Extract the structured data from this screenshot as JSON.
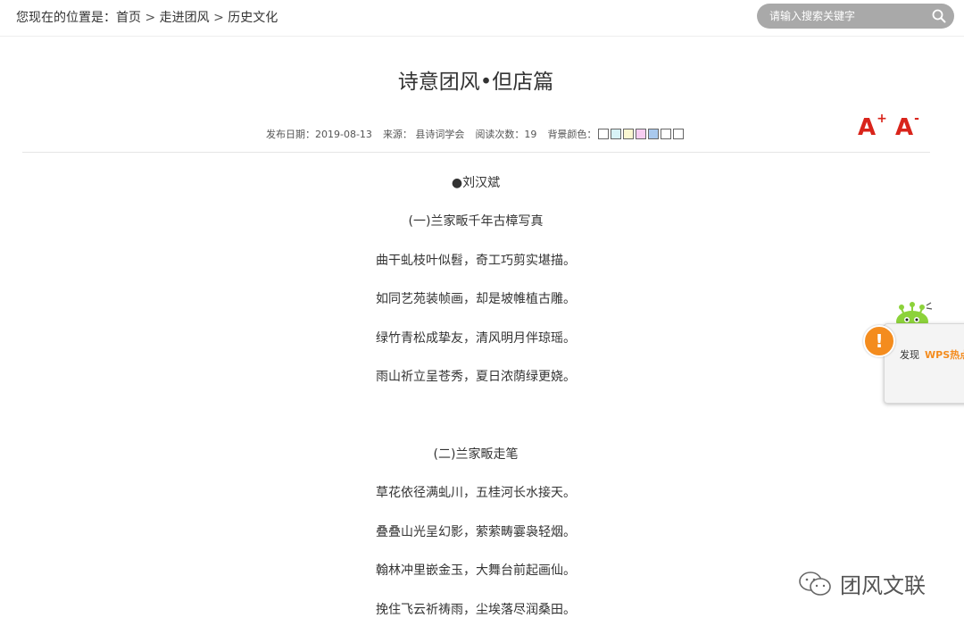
{
  "breadcrumb": {
    "prefix": "您现在的位置是：",
    "items": [
      "首页",
      "走进团风",
      "历史文化"
    ],
    "separator": ">"
  },
  "search": {
    "placeholder": "请输入搜索关键字",
    "icon": "search-icon"
  },
  "article": {
    "title": "诗意团风•但店篇",
    "meta": {
      "date_label": "发布日期：2019-08-13",
      "source_label": "来源：  县诗词学会",
      "views_label": "阅读次数：19",
      "bg_label": "背景颜色："
    },
    "bg_colors": [
      "#ffffff",
      "#d8f3f7",
      "#fbf7d1",
      "#f6cdf2",
      "#a9c9ee",
      "#ffffff",
      "#ffffff"
    ],
    "font_controls": {
      "increase": "A",
      "increase_sup": "+",
      "decrease": "A",
      "decrease_sup": "-"
    },
    "author": "●刘汉斌",
    "lines": [
      "(一)兰家畈千年古樟写真",
      "曲干虬枝叶似髫，奇工巧剪实堪描。",
      "如同艺苑装帧画，却是坡帷植古雕。",
      "绿竹青松成挚友，清风明月伴琼瑶。",
      "雨山祈立呈苍秀，夏日浓荫绿更娆。",
      "(二)兰家畈走笔",
      "草花依径满虬川，五桂河长水接天。",
      "叠叠山光呈幻影，萦萦畴霎袅轻烟。",
      "翰林冲里嵌金玉，大舞台前起画仙。",
      "挽住飞云祈祷雨，尘埃落尽润桑田。"
    ]
  },
  "wps_popup": {
    "alert": "!",
    "text": "发现",
    "brand": "WPS热点"
  },
  "watermark": {
    "text": "团风文联",
    "icon": "wechat-icon"
  },
  "colors": {
    "accent_red": "#d9241b",
    "search_bg": "#a9a9a9",
    "wps_orange": "#f48c1e"
  }
}
